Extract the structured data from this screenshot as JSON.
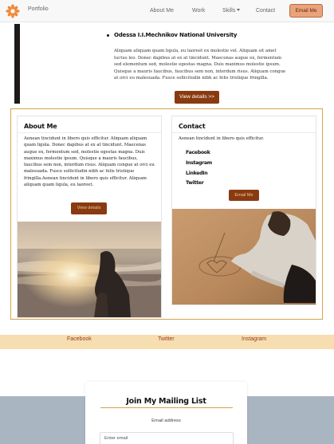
{
  "navbar": {
    "brand": "Portfolio",
    "logo_icon": "flower-logo-icon",
    "links": [
      "About Me",
      "Work",
      "Skills",
      "Contact"
    ],
    "email_button": "Email Me",
    "accent_color": "#e9a27a"
  },
  "experience": {
    "university": "Odessa I.I.Mechnikov National University",
    "description": "Aliquam aliquam quam ligula, eu laoreet ex molestie vel. Aliquam sit amet luctus leo. Donec dapibus at ex at tincidunt. Maecenas augue ex, fermentum sed elementum sed, molestie egestas magna. Duis maximus molestie ipsum. Quisque a mauris faucibus, faucibus sem non, interdum risus. Aliquam congue at orci eu malesuada. Fusce sollicitudin nibh ac felis tristique fringilla.",
    "view_details": "View details >>"
  },
  "about": {
    "title": "About Me",
    "text": "Aenean tincidunt in libero quis efficitur. Aliquam aliquam quam ligula. Donec dapibus at ex at tincidunt. Maecenas augue ex, fermentum sed, molestie egestas magna. Duis maximus molestie ipsum. Quisque a mauris faucibus, faucibus sem non, interdum risus. Aliquam congue at orci eu malesuada. Fusce sollicitudin nibh ac felis tristique fringilla.Aenean tincidunt in libero quis efficitur. Aliquam aliquam quam ligula, eu laoreet.",
    "button": "View details"
  },
  "contact": {
    "title": "Contact",
    "text": "Aenean tincidunt in libero quis efficitur.",
    "socials": [
      "Facebook",
      "Instagram",
      "LinkedIn",
      "Twitter"
    ],
    "button": "Email Me"
  },
  "social_bar": {
    "links": [
      "Facebook",
      "Twitter",
      "Instagram"
    ],
    "color": "#f7deb0"
  },
  "mailing": {
    "title": "Join My Mailing List",
    "label": "Email address",
    "placeholder": "Enter email"
  },
  "colors": {
    "button_dark": "#8a3a10",
    "card_border": "#d4a34a"
  }
}
